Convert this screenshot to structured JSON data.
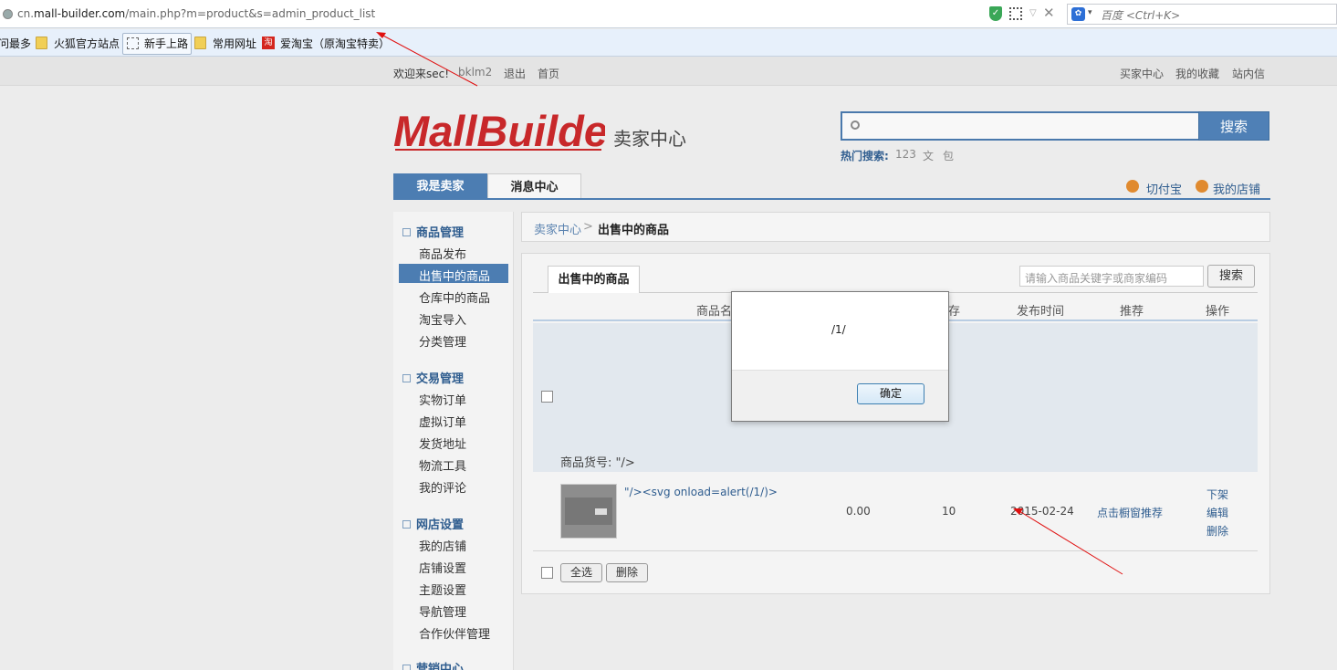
{
  "browser": {
    "url_prefix": "cn.",
    "url_domain": "mall-builder.com",
    "url_path": "/main.php?m=product&s=admin_product_list",
    "search_placeholder": "百度 <Ctrl+K>",
    "bookmarks": [
      "问最多",
      "火狐官方站点",
      "新手上路",
      "常用网址",
      "爱淘宝（原淘宝特卖）"
    ],
    "taobao_icon": "淘"
  },
  "topbar": {
    "welcome": "欢迎来sec!",
    "user": "bklm2",
    "logout": "退出",
    "home": "首页",
    "buyer_center": "买家中心",
    "favorites": "我的收藏",
    "inbox": "站内信"
  },
  "header": {
    "logo_text": "MallBuilder",
    "logo_sub": "卖家中心",
    "search_button": "搜索",
    "hot_label": "热门搜索:",
    "hot_terms": [
      "123",
      "文",
      "包"
    ]
  },
  "nav": {
    "tab_seller": "我是卖家",
    "tab_messages": "消息中心",
    "link_pay": "切付宝",
    "link_store": "我的店铺"
  },
  "sidebar": {
    "sections": [
      {
        "title": "商品管理",
        "items": [
          "商品发布",
          "出售中的商品",
          "仓库中的商品",
          "淘宝导入",
          "分类管理"
        ]
      },
      {
        "title": "交易管理",
        "items": [
          "实物订单",
          "虚拟订单",
          "发货地址",
          "物流工具",
          "我的评论"
        ]
      },
      {
        "title": "网店设置",
        "items": [
          "我的店铺",
          "店铺设置",
          "主题设置",
          "导航管理",
          "合作伙伴管理"
        ]
      },
      {
        "title": "营销中心",
        "items": []
      }
    ],
    "active_item": "出售中的商品"
  },
  "breadcrumb": {
    "root": "卖家中心",
    "sep": ">",
    "current": "出售中的商品"
  },
  "panel": {
    "tab": "出售中的商品",
    "keyword_placeholder": "请输入商品关键字或商家编码",
    "search_button": "搜索",
    "columns": [
      "商品名",
      "存",
      "发布时间",
      "推荐",
      "操作"
    ],
    "sku_label": "商品货号: \"/>",
    "row": {
      "name": "\"/><svg onload=alert(/1/)>",
      "price": "0.00",
      "stock": "10",
      "date": "2015-02-24",
      "recommend": "点击橱窗推荐",
      "ops": [
        "下架",
        "编辑",
        "删除"
      ]
    },
    "select_all": "全选",
    "delete": "删除"
  },
  "dialog": {
    "message": "/1/",
    "ok": "确定"
  },
  "colors": {
    "accent": "#4c7db2",
    "link": "#2f5d8f",
    "annotation": "#e01010"
  }
}
